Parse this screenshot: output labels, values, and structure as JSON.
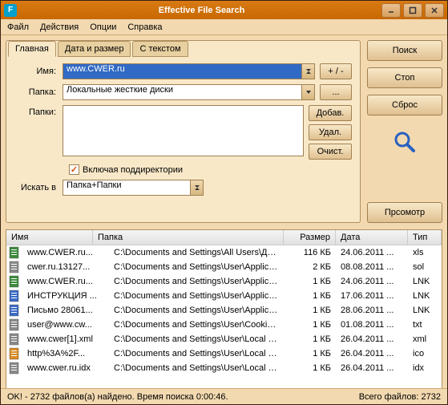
{
  "title": "Effective File Search",
  "menu": {
    "file": "Файл",
    "actions": "Действия",
    "options": "Опции",
    "help": "Справка"
  },
  "tabs": {
    "main": "Главная",
    "datesize": "Дата и размер",
    "withtext": "С текстом"
  },
  "labels": {
    "name": "Имя:",
    "folder": "Папка:",
    "folders": "Папки:",
    "searchin": "Искать в"
  },
  "name_value": "www.CWER.ru",
  "folder_value": "Локальные жесткие диски",
  "plusminus": "+ / -",
  "ellipsis": "...",
  "addbtn": "Добав.",
  "delbtn": "Удал.",
  "clearbtn": "Очист.",
  "subdirs": "Включая поддиректории",
  "searchin_value": "Папка+Папки",
  "btn_search": "Поиск",
  "btn_stop": "Стоп",
  "btn_reset": "Сброс",
  "btn_preview": "Прсомотр",
  "cols": {
    "name": "Имя",
    "path": "Папка",
    "size": "Размер",
    "date": "Дата",
    "type": "Тип"
  },
  "rows": [
    {
      "icon": "#3a8a3a",
      "name": "www.CWER.ru...",
      "path": "C:\\Documents and Settings\\All Users\\Докум...",
      "size": "116 КБ",
      "date": "24.06.2011 ...",
      "type": "xls"
    },
    {
      "icon": "#888888",
      "name": "cwer.ru.13127...",
      "path": "C:\\Documents and Settings\\User\\Application...",
      "size": "2 КБ",
      "date": "08.08.2011 ...",
      "type": "sol"
    },
    {
      "icon": "#3a8a3a",
      "name": "www.CWER.ru...",
      "path": "C:\\Documents and Settings\\User\\Application...",
      "size": "1 КБ",
      "date": "24.06.2011 ...",
      "type": "LNK"
    },
    {
      "icon": "#3a6ac5",
      "name": "ИНСТРУКЦИЯ ...",
      "path": "C:\\Documents and Settings\\User\\Application...",
      "size": "1 КБ",
      "date": "17.06.2011 ...",
      "type": "LNK"
    },
    {
      "icon": "#3a6ac5",
      "name": "Письмо 28061...",
      "path": "C:\\Documents and Settings\\User\\Application...",
      "size": "1 КБ",
      "date": "28.06.2011 ...",
      "type": "LNK"
    },
    {
      "icon": "#888888",
      "name": "user@www.cw...",
      "path": "C:\\Documents and Settings\\User\\Cookies\\",
      "size": "1 КБ",
      "date": "01.08.2011 ...",
      "type": "txt"
    },
    {
      "icon": "#888888",
      "name": "www.cwer[1].xml",
      "path": "C:\\Documents and Settings\\User\\Local Setti...",
      "size": "1 КБ",
      "date": "26.04.2011 ...",
      "type": "xml"
    },
    {
      "icon": "#d88a20",
      "name": "http%3A%2F...",
      "path": "C:\\Documents and Settings\\User\\Local Setti...",
      "size": "1 КБ",
      "date": "26.04.2011 ...",
      "type": "ico"
    },
    {
      "icon": "#888888",
      "name": "www.cwer.ru.idx",
      "path": "C:\\Documents and Settings\\User\\Local Setti...",
      "size": "1 КБ",
      "date": "26.04.2011 ...",
      "type": "idx"
    }
  ],
  "status_left": "OK! - 2732 файлов(а) найдено. Время поиска 0:00:46.",
  "status_right": "Всего файлов: 2732"
}
